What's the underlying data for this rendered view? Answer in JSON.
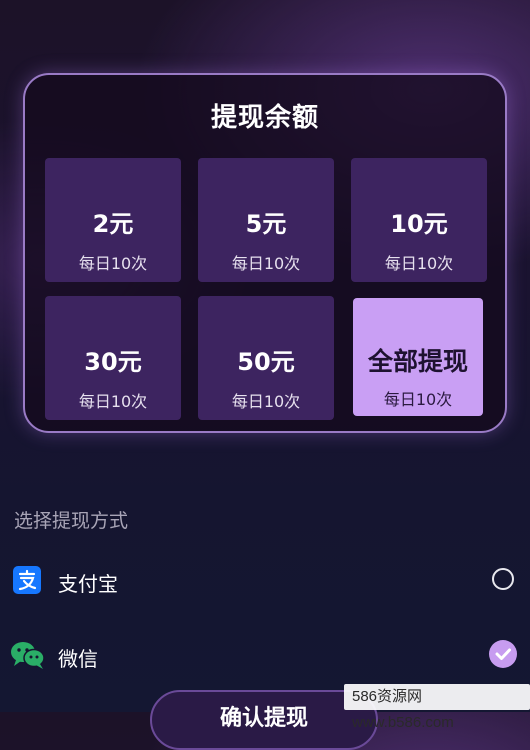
{
  "panel": {
    "title": "提现余额",
    "options": [
      {
        "amount": "2元",
        "limit": "每日10次",
        "selected": false
      },
      {
        "amount": "5元",
        "limit": "每日10次",
        "selected": false
      },
      {
        "amount": "10元",
        "limit": "每日10次",
        "selected": false
      },
      {
        "amount": "30元",
        "limit": "每日10次",
        "selected": false
      },
      {
        "amount": "50元",
        "limit": "每日10次",
        "selected": false
      },
      {
        "amount": "全部提现",
        "limit": "每日10次",
        "selected": true
      }
    ]
  },
  "payment": {
    "section_label": "选择提现方式",
    "methods": [
      {
        "label": "支付宝",
        "icon": "alipay-icon",
        "checked": false
      },
      {
        "label": "微信",
        "icon": "wechat-icon",
        "checked": true
      }
    ]
  },
  "confirm_label": "确认提现",
  "watermark": "586资源网 www.b586.com",
  "colors": {
    "accent": "#c99ff4",
    "tile": "#3d2460",
    "alipay": "#1677ff",
    "wechat": "#2aae67"
  }
}
